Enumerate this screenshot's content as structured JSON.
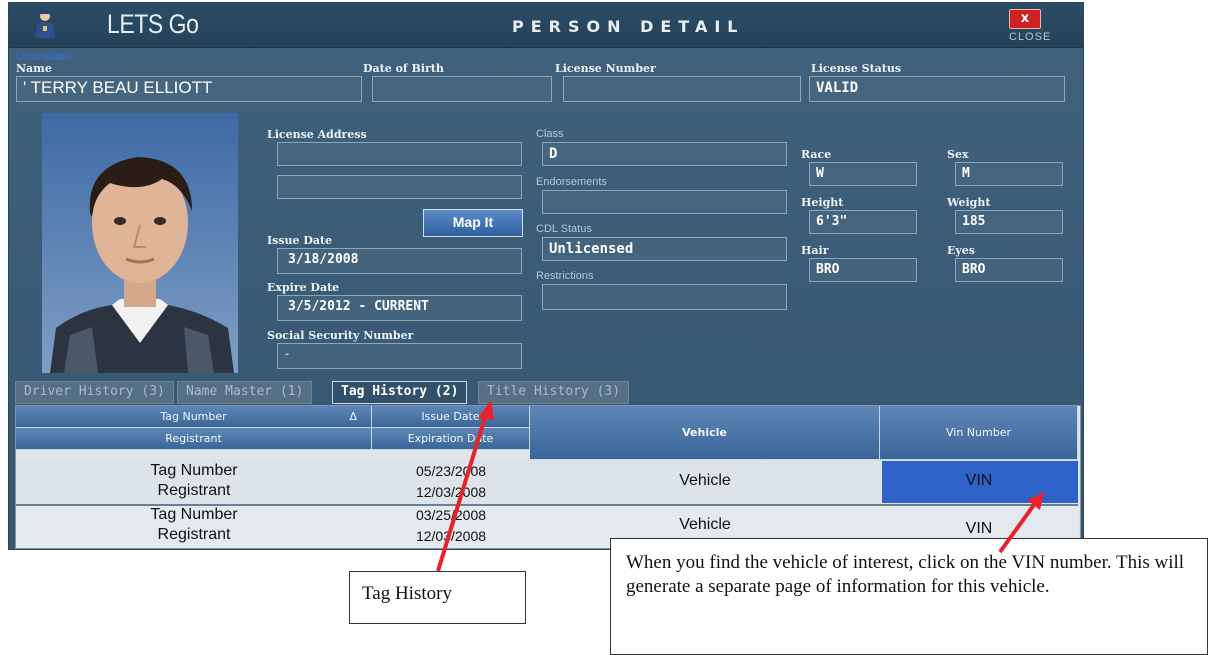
{
  "header": {
    "app_title": "LETS Go",
    "window_title": "PERSON DETAIL",
    "close_label": "CLOSE",
    "close_glyph": "x"
  },
  "person": {
    "unavailable_text": "Unavailable",
    "name_label": "Name",
    "name_value": "' TERRY BEAU ELLIOTT",
    "dob_label": "Date of Birth",
    "dob_value": "",
    "license_number_label": "License Number",
    "license_number_value": "",
    "license_status_label": "License Status",
    "license_status_value": "VALID",
    "license_address_label": "License Address",
    "address_line1": "",
    "address_line2": "",
    "map_button": "Map It",
    "issue_date_label": "Issue Date",
    "issue_date_value": "3/18/2008",
    "expire_date_label": "Expire Date",
    "expire_date_value": "3/5/2012 - CURRENT",
    "ssn_label": "Social Security Number",
    "ssn_value": "-",
    "class_label": "Class",
    "class_value": "D",
    "endorsements_label": "Endorsements",
    "endorsements_value": "",
    "cdl_status_label": "CDL Status",
    "cdl_status_value": "Unlicensed",
    "restrictions_label": "Restrictions",
    "restrictions_value": "",
    "race_label": "Race",
    "race_value": "W",
    "sex_label": "Sex",
    "sex_value": "M",
    "height_label": "Height",
    "height_value": "6'3\"",
    "weight_label": "Weight",
    "weight_value": "185",
    "hair_label": "Hair",
    "hair_value": "BRO",
    "eyes_label": "Eyes",
    "eyes_value": "BRO"
  },
  "tabs": [
    {
      "label": "Driver History (3)"
    },
    {
      "label": "Name Master (1)"
    },
    {
      "label": "Tag History (2)"
    },
    {
      "label": "Title History (3)"
    }
  ],
  "table": {
    "headers": {
      "tag_number": "Tag Number",
      "sort_glyph": "Δ",
      "registrant": "Registrant",
      "issue_date": "Issue Date",
      "expiration_date": "Expiration Date",
      "vehicle": "Vehicle",
      "vin_number": "Vin Number"
    },
    "rows": [
      {
        "tag": "Tag Number",
        "registrant": "Registrant",
        "issue": "05/23/2008",
        "expiration": "12/03/2008",
        "vehicle": "Vehicle",
        "vin": "VIN"
      },
      {
        "tag": "Tag Number",
        "registrant": "Registrant",
        "issue": "03/25/2008",
        "expiration": "12/03/2008",
        "vehicle": "Vehicle",
        "vin": "VIN"
      }
    ]
  },
  "annotations": {
    "tag_history_callout": "Tag History",
    "vin_callout": "When you find the vehicle of interest, click on the VIN number. This will generate a separate page of information for this vehicle."
  },
  "colors": {
    "panel": "#3a5b77",
    "header_blue": "#3b6699",
    "vin_highlight": "#2e62c9",
    "arrow": "#e8212b"
  }
}
